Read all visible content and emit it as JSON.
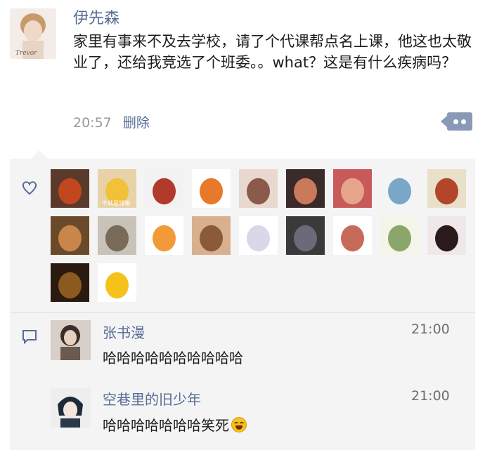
{
  "post": {
    "author": "伊先森",
    "text": "家里有事来不及去学校，请了个代课帮点名上课，他这也太敬业了，还给我竞选了个班委。。what？这是有什么疾病吗？",
    "time": "20:57",
    "delete_label": "删除",
    "avatar_caption": "Trevor"
  },
  "likes": {
    "icon": "heart-outline-icon",
    "avatar_colors": [
      [
        "#5a3a2a",
        "#c2461e"
      ],
      [
        "#e8d2a8",
        "#f1c13a"
      ],
      [
        "#f2f2f2",
        "#b23a2a"
      ],
      [
        "#ffffff",
        "#e8782a"
      ],
      [
        "#e8d8d0",
        "#8a5a4a"
      ],
      [
        "#3a2a2a",
        "#c87a5a"
      ],
      [
        "#c85a5a",
        "#e6a58a"
      ],
      [
        "#f4f4f4",
        "#7aa6c8"
      ],
      [
        "#e8e0c8",
        "#b2452a"
      ],
      [
        "#6a4a2a",
        "#c8864a"
      ],
      [
        "#c8c2b8",
        "#7a6a5a"
      ],
      [
        "#ffffff",
        "#f29a3a"
      ],
      [
        "#d8b090",
        "#8a5a3a"
      ],
      [
        "#ffffff",
        "#d8d8e8"
      ],
      [
        "#3a3a3a",
        "#6a6a7a"
      ],
      [
        "#ffffff",
        "#c86a5a"
      ],
      [
        "#f4f4e8",
        "#8aa66a"
      ],
      [
        "#f0e8e8",
        "#2a1a1a"
      ],
      [
        "#2a1a10",
        "#8a5a20"
      ],
      [
        "#ffffff",
        "#f4c21a"
      ]
    ],
    "avatar_label": "不就是钱嘛"
  },
  "comments": [
    {
      "name": "张书漫",
      "time": "21:00",
      "text": "哈哈哈哈哈哈哈哈哈哈",
      "emoji": "",
      "avatar_colors": [
        "#d8d0c8",
        "#6a5a50"
      ]
    },
    {
      "name": "空巷里的旧少年",
      "time": "21:00",
      "text": "哈哈哈哈哈哈哈笑死",
      "emoji": "laugh-cry-emoji",
      "avatar_colors": [
        "#eeeeee",
        "#2a3a4a"
      ]
    }
  ]
}
